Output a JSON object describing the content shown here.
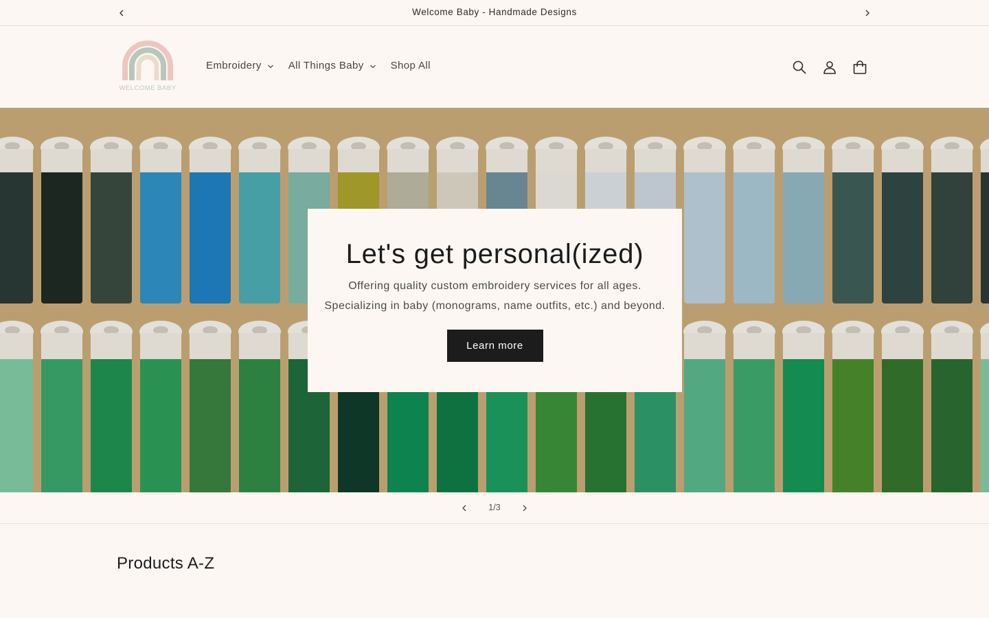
{
  "announcement": {
    "text": "Welcome Baby - Handmade Designs",
    "prev_icon": "chevron-left-icon",
    "next_icon": "chevron-right-icon"
  },
  "header": {
    "logo_text": "WELCOME BABY",
    "nav": [
      {
        "label": "Embroidery",
        "has_dropdown": true
      },
      {
        "label": "All Things Baby",
        "has_dropdown": true
      },
      {
        "label": "Shop All",
        "has_dropdown": false
      }
    ],
    "icons": [
      "search-icon",
      "account-icon",
      "cart-icon"
    ]
  },
  "hero": {
    "title": "Let's get personal(ized)",
    "line1": "Offering quality custom embroidery services for all ages.",
    "line2": "Specializing in baby (monograms, name outfits, etc.) and beyond.",
    "button_label": "Learn more"
  },
  "slider": {
    "counter": "1/3",
    "current": 1,
    "total": 3
  },
  "products": {
    "title": "Products A-Z"
  },
  "colors": {
    "page_bg": "#fdf7f3",
    "button_bg": "#1c1c1c",
    "button_text": "#ffffff",
    "logo_pink": "#ecc7c0",
    "logo_sage": "#b9c6bf"
  }
}
